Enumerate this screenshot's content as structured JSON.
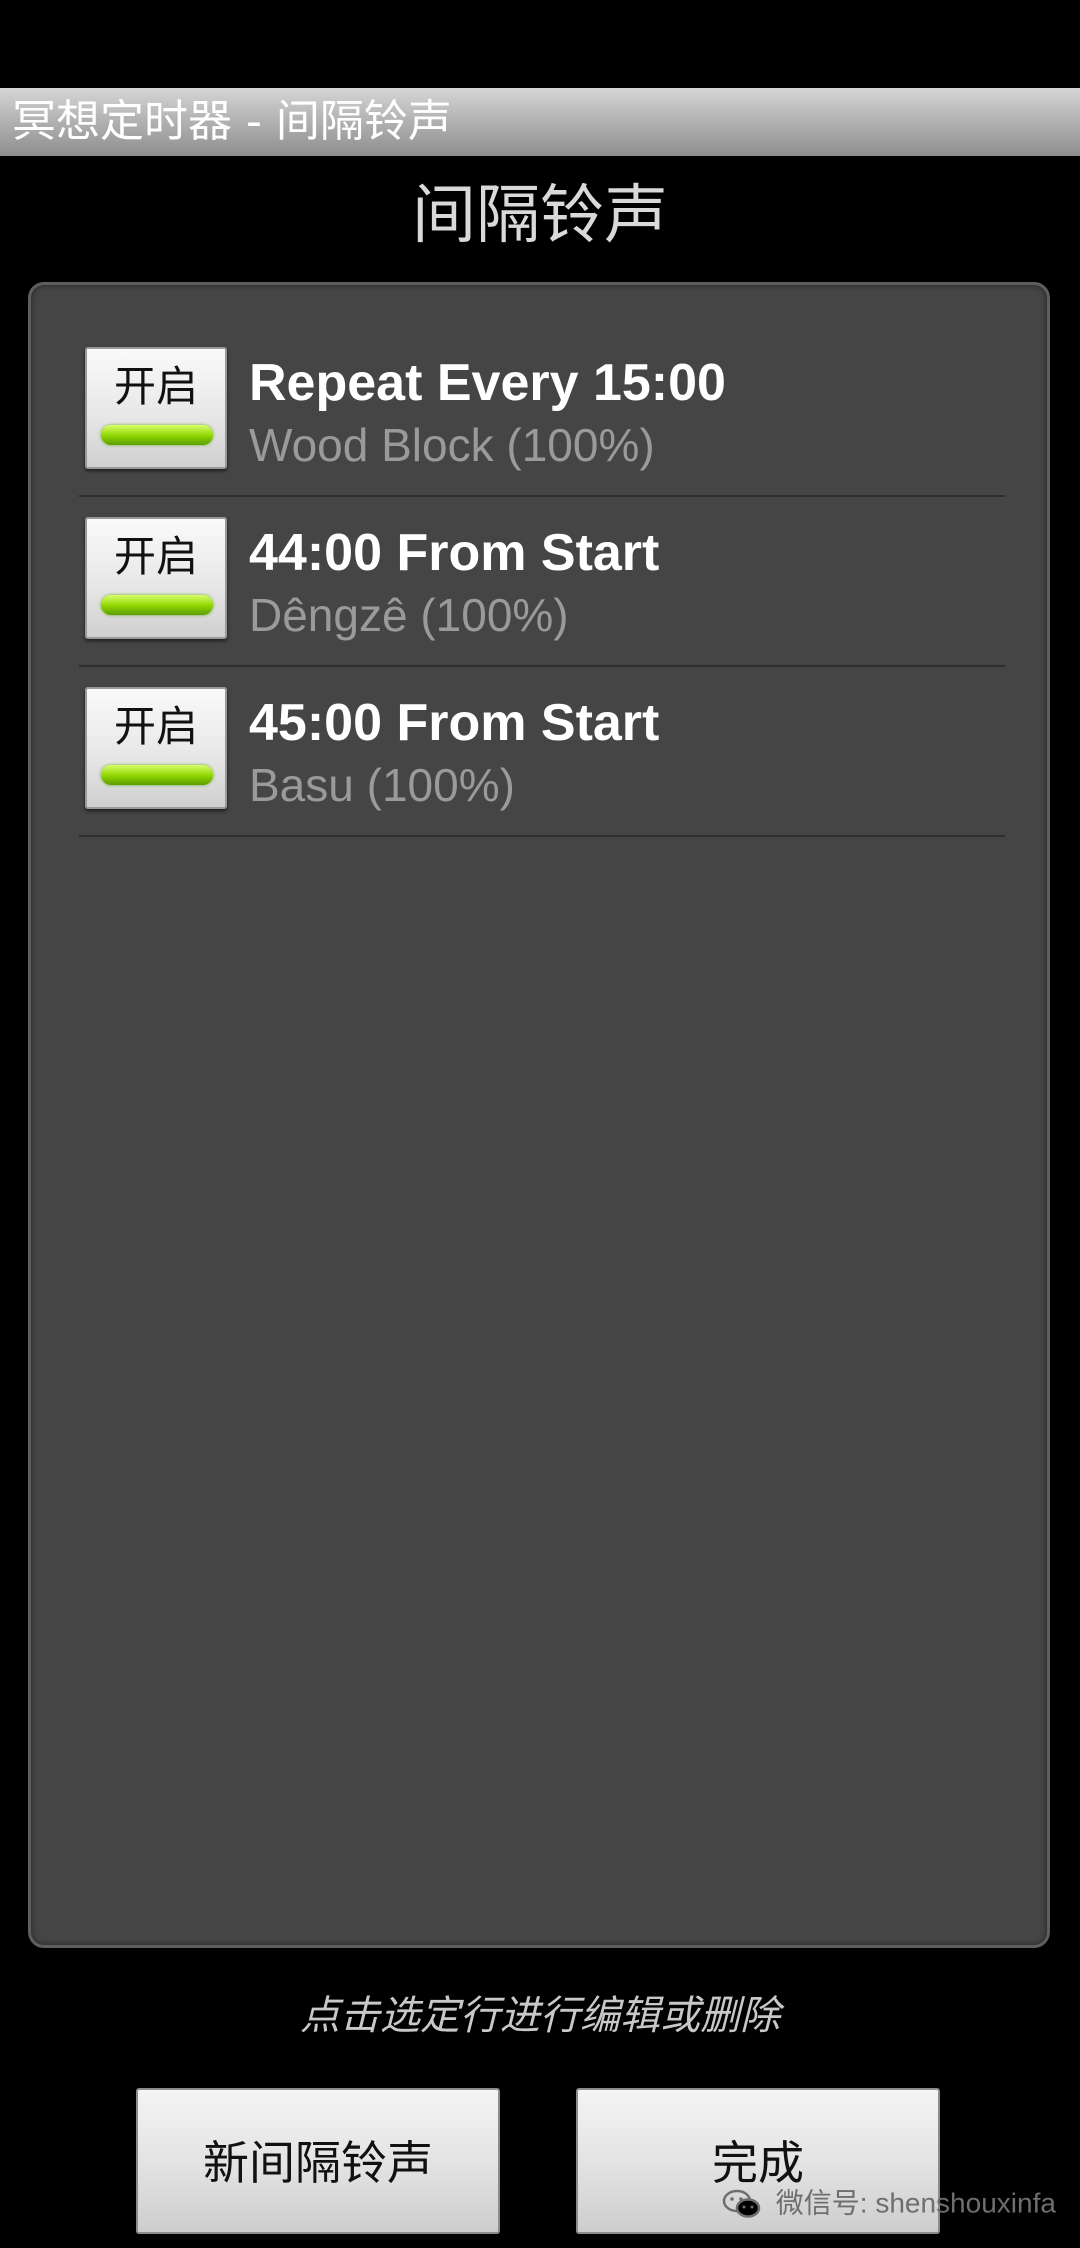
{
  "window": {
    "title": "冥想定时器 - 间隔铃声"
  },
  "page": {
    "heading": "间隔铃声",
    "hint": "点击选定行进行编辑或删除"
  },
  "bells": [
    {
      "toggle_label": "开启",
      "enabled": true,
      "title": "Repeat Every 15:00",
      "subtitle": "Wood Block (100%)"
    },
    {
      "toggle_label": "开启",
      "enabled": true,
      "title": "44:00 From Start",
      "subtitle": "Dêngzê (100%)"
    },
    {
      "toggle_label": "开启",
      "enabled": true,
      "title": "45:00 From Start",
      "subtitle": "Basu (100%)"
    }
  ],
  "actions": {
    "new_label": "新间隔铃声",
    "done_label": "完成"
  },
  "watermark": {
    "text": "微信号: shenshouxinfa",
    "icon": "wechat-icon"
  },
  "colors": {
    "toggle_on": "#8fd400",
    "panel": "#454545",
    "background": "#000000"
  }
}
